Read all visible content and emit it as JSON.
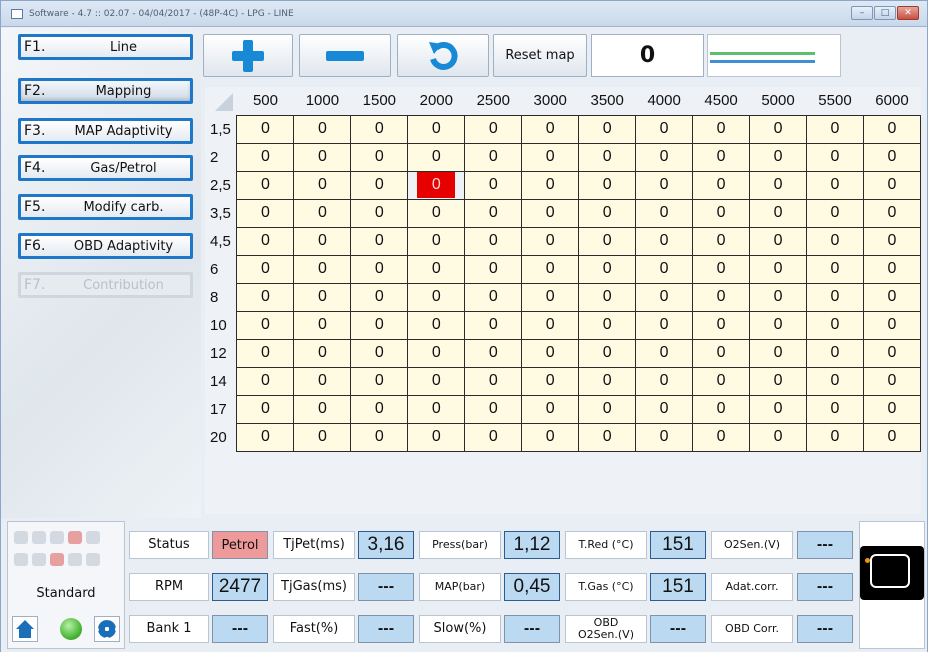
{
  "window": {
    "title": "Software - 4.7 :: 02.07 - 04/04/2017 - (48P-4C) - LPG - LINE",
    "controls": [
      "minimize",
      "maximize",
      "close"
    ]
  },
  "menu": [
    {
      "key": "F1.",
      "label": "Line",
      "state": "normal"
    },
    {
      "key": "F2.",
      "label": "Mapping",
      "state": "active"
    },
    {
      "key": "F3.",
      "label": "MAP Adaptivity",
      "state": "normal"
    },
    {
      "key": "F4.",
      "label": "Gas/Petrol",
      "state": "normal"
    },
    {
      "key": "F5.",
      "label": "Modify carb.",
      "state": "normal"
    },
    {
      "key": "F6.",
      "label": "OBD Adaptivity",
      "state": "normal"
    },
    {
      "key": "F7.",
      "label": "Contribution",
      "state": "disabled"
    }
  ],
  "toolbar": {
    "plus_icon": "plus-icon",
    "minus_icon": "minus-icon",
    "undo_icon": "undo-icon",
    "reset_label": "Reset map",
    "counter_value": "0"
  },
  "map": {
    "columns": [
      "500",
      "1000",
      "1500",
      "2000",
      "2500",
      "3000",
      "3500",
      "4000",
      "4500",
      "5000",
      "5500",
      "6000"
    ],
    "rows": [
      {
        "label": "1,5",
        "values": [
          "0",
          "0",
          "0",
          "0",
          "0",
          "0",
          "0",
          "0",
          "0",
          "0",
          "0",
          "0"
        ]
      },
      {
        "label": "2",
        "values": [
          "0",
          "0",
          "0",
          "0",
          "0",
          "0",
          "0",
          "0",
          "0",
          "0",
          "0",
          "0"
        ]
      },
      {
        "label": "2,5",
        "values": [
          "0",
          "0",
          "0",
          "0",
          "0",
          "0",
          "0",
          "0",
          "0",
          "0",
          "0",
          "0"
        ]
      },
      {
        "label": "3,5",
        "values": [
          "0",
          "0",
          "0",
          "0",
          "0",
          "0",
          "0",
          "0",
          "0",
          "0",
          "0",
          "0"
        ]
      },
      {
        "label": "4,5",
        "values": [
          "0",
          "0",
          "0",
          "0",
          "0",
          "0",
          "0",
          "0",
          "0",
          "0",
          "0",
          "0"
        ]
      },
      {
        "label": "6",
        "values": [
          "0",
          "0",
          "0",
          "0",
          "0",
          "0",
          "0",
          "0",
          "0",
          "0",
          "0",
          "0"
        ]
      },
      {
        "label": "8",
        "values": [
          "0",
          "0",
          "0",
          "0",
          "0",
          "0",
          "0",
          "0",
          "0",
          "0",
          "0",
          "0"
        ]
      },
      {
        "label": "10",
        "values": [
          "0",
          "0",
          "0",
          "0",
          "0",
          "0",
          "0",
          "0",
          "0",
          "0",
          "0",
          "0"
        ]
      },
      {
        "label": "12",
        "values": [
          "0",
          "0",
          "0",
          "0",
          "0",
          "0",
          "0",
          "0",
          "0",
          "0",
          "0",
          "0"
        ]
      },
      {
        "label": "14",
        "values": [
          "0",
          "0",
          "0",
          "0",
          "0",
          "0",
          "0",
          "0",
          "0",
          "0",
          "0",
          "0"
        ]
      },
      {
        "label": "17",
        "values": [
          "0",
          "0",
          "0",
          "0",
          "0",
          "0",
          "0",
          "0",
          "0",
          "0",
          "0",
          "0"
        ]
      },
      {
        "label": "20",
        "values": [
          "0",
          "0",
          "0",
          "0",
          "0",
          "0",
          "0",
          "0",
          "0",
          "0",
          "0",
          "0"
        ]
      }
    ],
    "selected": {
      "row": 2,
      "col": 3
    },
    "selected_color": "#e60000",
    "cell_color": "#fffbe3"
  },
  "status_panel": {
    "mode": "Standard",
    "led_color": "#4cb838"
  },
  "readouts": {
    "status_label": "Status",
    "status_value": "Petrol",
    "rpm_label": "RPM",
    "rpm_value": "2477",
    "bank_label": "Bank 1",
    "bank_value": "---",
    "tjpet_label": "TjPet(ms)",
    "tjpet_value": "3,16",
    "tjgas_label": "TjGas(ms)",
    "tjgas_value": "---",
    "fast_label": "Fast(%)",
    "fast_value": "---",
    "press_label": "Press(bar)",
    "press_value": "1,12",
    "map_label": "MAP(bar)",
    "map_value": "0,45",
    "slow_label": "Slow(%)",
    "slow_value": "---",
    "tred_label": "T.Red (°C)",
    "tred_value": "151",
    "tgas_label": "T.Gas (°C)",
    "tgas_value": "151",
    "obd_o2_label": "OBD O2Sen.(V)",
    "obd_o2_value": "---",
    "o2sen_label": "O2Sen.(V)",
    "o2sen_value": "---",
    "adat_label": "Adat.corr.",
    "adat_value": "---",
    "obdcorr_label": "OBD Corr.",
    "obdcorr_value": "---"
  }
}
